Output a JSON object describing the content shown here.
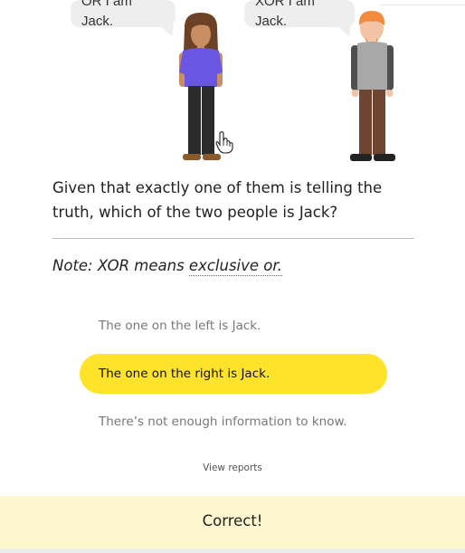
{
  "illustration": {
    "left_speech": "OR I am Jack.",
    "right_speech": "XOR I am Jack."
  },
  "question": {
    "text": "Given that exactly one of them is telling the truth, which of the two people is Jack?"
  },
  "note": {
    "prefix": "Note: XOR means ",
    "term": "exclusive or."
  },
  "choices": [
    {
      "label": "The one on the left is Jack.",
      "selected": false
    },
    {
      "label": "The one on the right is Jack.",
      "selected": true
    },
    {
      "label": "There’s not enough information to know.",
      "selected": false
    }
  ],
  "view_reports_label": "View reports",
  "feedback": {
    "text": "Correct!"
  },
  "colors": {
    "selected_choice": "#ffe22a",
    "feedback_bg": "#fdf6cf",
    "left_shirt": "#6a56e0",
    "right_hair": "#f28b3b"
  }
}
